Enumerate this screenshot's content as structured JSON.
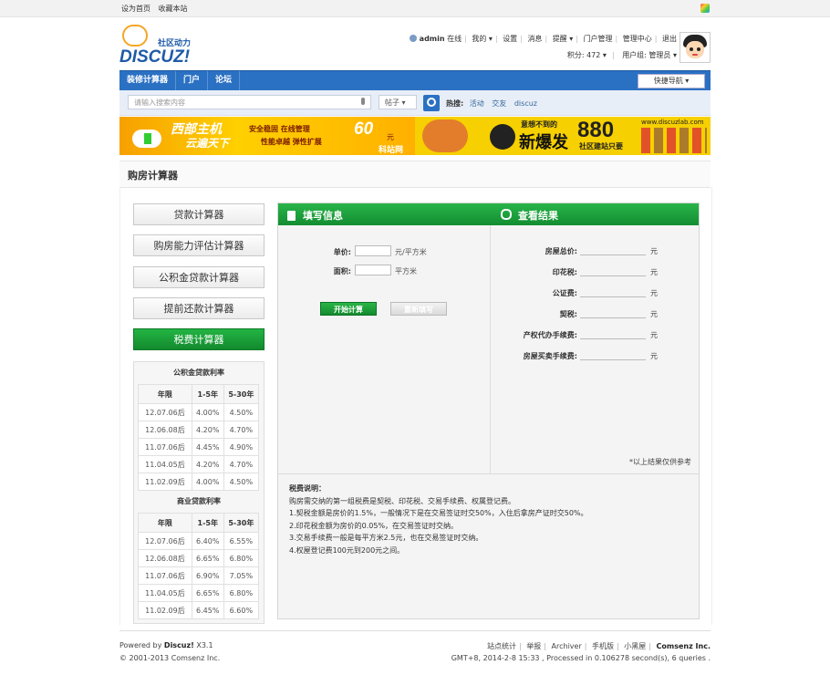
{
  "topbar": {
    "set_home": "设为首页",
    "bookmark": "收藏本站"
  },
  "logo": {
    "name": "DISCUZ!",
    "tagline": "社区动力"
  },
  "user": {
    "name": "admin",
    "status": "在线",
    "links": [
      "我的",
      "设置",
      "消息",
      "提醒",
      "门户管理",
      "管理中心",
      "退出"
    ],
    "points_label": "积分: 472",
    "group_label": "用户组: 管理员"
  },
  "nav": {
    "items": [
      "装修计算器",
      "门户",
      "论坛"
    ],
    "quick_nav": "快捷导航"
  },
  "search": {
    "placeholder": "请输入搜索内容",
    "scope": "帖子",
    "hot_label": "热搜:",
    "hot": [
      "活动",
      "交友",
      "discuz"
    ]
  },
  "ads": {
    "left": {
      "title": "西部主机",
      "subtitle": "云遍天下",
      "slogan1": "安全稳固  在线管理",
      "slogan2": "性能卓越  弹性扩展",
      "price": "60",
      "unit": "元",
      "brand": "科站网"
    },
    "right": {
      "line1": "意想不到的",
      "line2": "新爆发",
      "num": "880",
      "line3": "社区建站只要",
      "url": "www.discuzlab.com"
    }
  },
  "page": {
    "title": "购房计算器"
  },
  "left_menu": [
    "贷款计算器",
    "购房能力评估计算器",
    "公积金贷款计算器",
    "提前还款计算器",
    "税费计算器"
  ],
  "rates": {
    "fund": {
      "caption": "公积金贷款利率",
      "headers": [
        "年限",
        "1-5年",
        "5-30年"
      ],
      "rows": [
        [
          "12.07.06后",
          "4.00%",
          "4.50%"
        ],
        [
          "12.06.08后",
          "4.20%",
          "4.70%"
        ],
        [
          "11.07.06后",
          "4.45%",
          "4.90%"
        ],
        [
          "11.04.05后",
          "4.20%",
          "4.70%"
        ],
        [
          "11.02.09后",
          "4.00%",
          "4.50%"
        ]
      ]
    },
    "commercial": {
      "caption": "商业贷款利率",
      "headers": [
        "年限",
        "1-5年",
        "5-30年"
      ],
      "rows": [
        [
          "12.07.06后",
          "6.40%",
          "6.55%"
        ],
        [
          "12.06.08后",
          "6.65%",
          "6.80%"
        ],
        [
          "11.07.06后",
          "6.90%",
          "7.05%"
        ],
        [
          "11.04.05后",
          "6.65%",
          "6.80%"
        ],
        [
          "11.02.09后",
          "6.45%",
          "6.60%"
        ]
      ]
    }
  },
  "form": {
    "title": "填写信息",
    "unit_price_label": "单价:",
    "unit_price_unit": "元/平方米",
    "area_label": "面积:",
    "area_unit": "平方米",
    "calc_button": "开始计算",
    "reset_button": "重新填写"
  },
  "result": {
    "title": "查看结果",
    "items": [
      "房屋总价:",
      "印花税:",
      "公证费:",
      "契税:",
      "产权代办手续费:",
      "房屋买卖手续费:"
    ],
    "unit": "元",
    "note": "*以上结果仅供参考"
  },
  "tax_note": {
    "title": "税费说明：",
    "lines": [
      "购房需交纳的第一组税费是契税、印花税、交易手续费、权属登记费。",
      "1.契税金额是房价的1.5%，一般情况下是在交易签证时交50%，入住后拿房产证时交50%。",
      "2.印花税金额为房价的0.05%，在交易签证时交纳。",
      "3.交易手续费一般是每平方米2.5元，也在交易签证时交纳。",
      "4.权屋登记费100元到200元之间。"
    ]
  },
  "footer": {
    "powered_prefix": "Powered by",
    "powered_brand": "Discuz!",
    "powered_version": "X3.1",
    "copyright": "© 2001-2013 Comsenz Inc.",
    "links": [
      "站点统计",
      "举报",
      "Archiver",
      "手机版",
      "小黑屋"
    ],
    "company": "Comsenz Inc.",
    "stats": "GMT+8, 2014-2-8 15:33 , Processed in 0.106278 second(s), 6 queries ."
  }
}
